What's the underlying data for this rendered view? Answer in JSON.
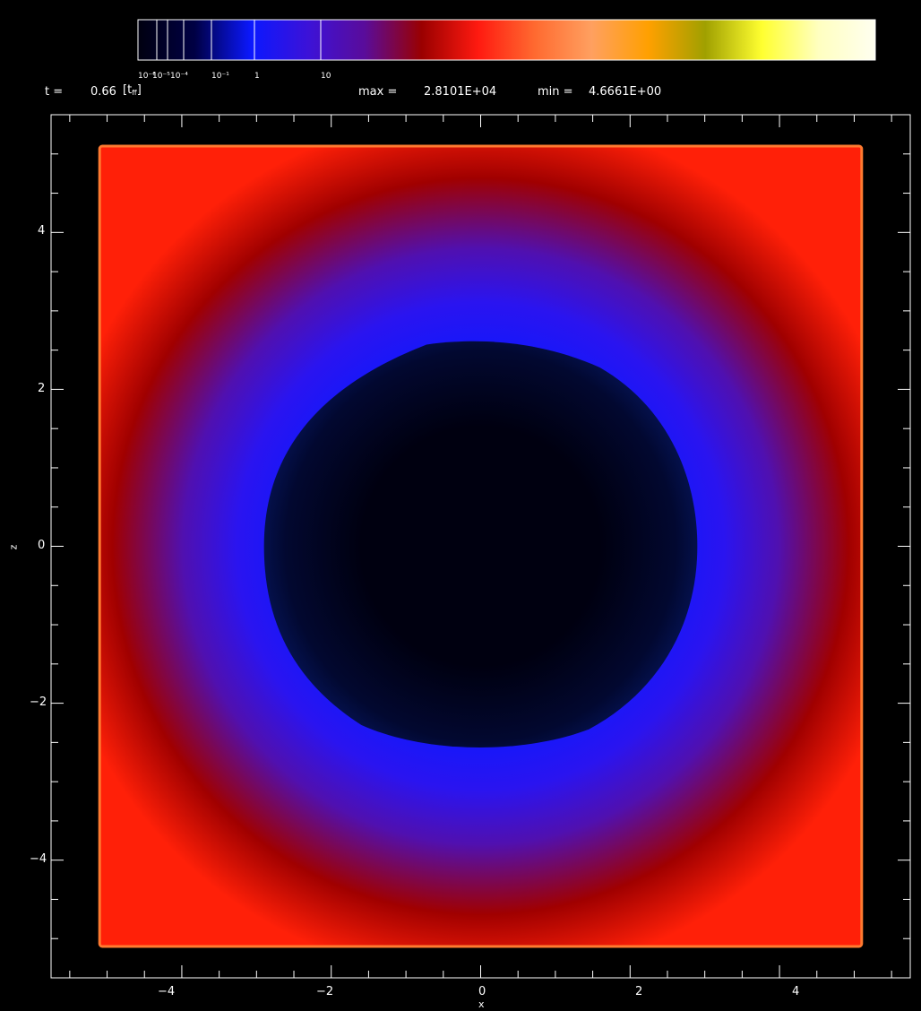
{
  "header": {
    "time_prefix": "t =",
    "time_value": "0.66",
    "time_unit_open": "[t",
    "time_unit_sub": "ff",
    "time_unit_close": "]",
    "max_label": "max =",
    "max_value": "2.8101E+04",
    "min_label": "min =",
    "min_value": "4.6661E+00"
  },
  "colorbar": {
    "scale": "log",
    "stops": [
      "#000010",
      "#000044",
      "#0b18ff",
      "#3c12d8",
      "#5a0c9a",
      "#9a0000",
      "#ff1a10",
      "#ff6a30",
      "#ffa060",
      "#ffa000",
      "#a0a000",
      "#ffff30",
      "#ffffc0",
      "#fffff0"
    ],
    "ticks": [
      "10⁻⁶",
      "10⁻⁵",
      "10⁻⁴",
      "10⁻¹",
      "1",
      "10"
    ]
  },
  "chart_data": {
    "type": "heatmap",
    "xlabel": "x",
    "ylabel": "z",
    "xlim": [
      -5.75,
      5.75
    ],
    "ylim": [
      -5.5,
      5.5
    ],
    "xticks": [
      -4,
      -2,
      0,
      2,
      4
    ],
    "yticks": [
      -4,
      -2,
      0,
      2,
      4
    ],
    "x_tick_labels": [
      "−4",
      "−2",
      "0",
      "2",
      "4"
    ],
    "y_tick_labels": [
      "−4",
      "−2",
      "0",
      "2",
      "4"
    ],
    "domain_half_width": 5.1,
    "inner_region_radius_x": 2.9,
    "inner_region_radius_z": 2.65,
    "colors": {
      "background": "#000000",
      "core": "#000010",
      "inner": "#020830",
      "shell_blue": "#0c18ff",
      "shell_purple": "#5010b0",
      "shell_red": "#a00000",
      "edge_red": "#ff2008",
      "boundary": "#ff7a30"
    }
  }
}
